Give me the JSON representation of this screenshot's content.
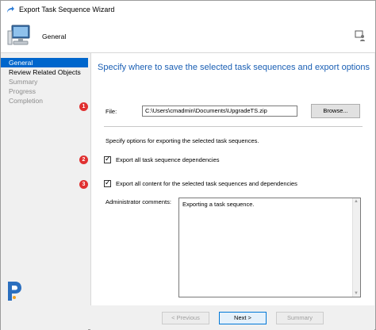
{
  "window": {
    "title": "Export Task Sequence Wizard"
  },
  "header": {
    "title": "General"
  },
  "nav": {
    "items": [
      {
        "label": "General"
      },
      {
        "label": "Review Related Objects"
      },
      {
        "label": "Summary"
      },
      {
        "label": "Progress"
      },
      {
        "label": "Completion"
      }
    ]
  },
  "content": {
    "title": "Specify where to save the selected task sequences and export options",
    "file_label": "File:",
    "file_value": "C:\\Users\\cmadmin\\Documents\\UpgradeTS.zip",
    "browse_label": "Browse...",
    "options_text": "Specify options for exporting the selected task sequences.",
    "checkbox1_label": "Export all task sequence dependencies",
    "checkbox1_checked": true,
    "checkbox2_label": "Export all content for the selected task sequences and dependencies",
    "checkbox2_checked": true,
    "comments_label": "Administrator comments:",
    "comments_value": "Exporting a task sequence."
  },
  "annotations": {
    "badge1": "1",
    "badge2": "2",
    "badge3": "3"
  },
  "footer": {
    "previous": "< Previous",
    "next": "Next >",
    "summary": "Summary"
  },
  "colors": {
    "accent": "#0066cc",
    "title_blue": "#1a5fb4",
    "badge_red": "#e03030"
  }
}
